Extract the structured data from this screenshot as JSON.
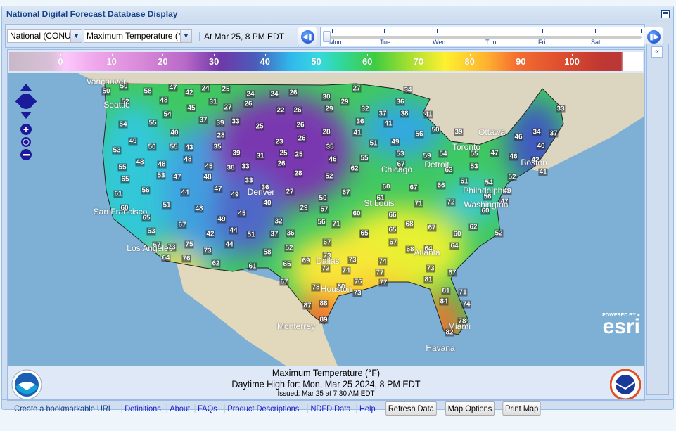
{
  "window": {
    "title": "National Digital Forecast Database Display"
  },
  "toolbar": {
    "region_select": "National (CONUS",
    "element_select": "Maximum Temperature (°F",
    "valid_time": "At Mar 25,   8 PM EDT",
    "timeline_days": [
      "Mon",
      "Tue",
      "Wed",
      "Thu",
      "Fri",
      "Sat"
    ],
    "timeline_position": 0
  },
  "legend": {
    "ticks": [
      "0",
      "10",
      "20",
      "30",
      "40",
      "50",
      "60",
      "70",
      "80",
      "90",
      "100"
    ],
    "unit": "°F"
  },
  "map": {
    "temperature_labels": [
      "50",
      "50",
      "58",
      "47",
      "42",
      "24",
      "25",
      "24",
      "24",
      "26",
      "30",
      "29",
      "27",
      "52",
      "48",
      "31",
      "27",
      "26",
      "22",
      "26",
      "29",
      "32",
      "45",
      "54",
      "54",
      "55",
      "37",
      "39",
      "33",
      "25",
      "26",
      "36",
      "40",
      "28",
      "28",
      "41",
      "49",
      "50",
      "55",
      "43",
      "35",
      "39",
      "31",
      "23",
      "26",
      "35",
      "53",
      "25",
      "25",
      "48",
      "48",
      "48",
      "26",
      "46",
      "55",
      "55",
      "45",
      "38",
      "33",
      "28",
      "62",
      "65",
      "53",
      "47",
      "48",
      "33",
      "52",
      "61",
      "56",
      "44",
      "47",
      "49",
      "36",
      "27",
      "67",
      "50",
      "60",
      "51",
      "48",
      "40",
      "29",
      "57",
      "60",
      "45",
      "34",
      "36",
      "37",
      "38",
      "41",
      "41",
      "50",
      "39",
      "56",
      "49",
      "51",
      "53",
      "59",
      "54",
      "55",
      "47",
      "46",
      "34",
      "37",
      "33",
      "40",
      "46",
      "42",
      "41",
      "67",
      "63",
      "53",
      "52",
      "61",
      "54",
      "60",
      "67",
      "66",
      "49",
      "56",
      "47",
      "61",
      "71",
      "72",
      "60",
      "66",
      "65",
      "63",
      "67",
      "49",
      "44",
      "42",
      "51",
      "37",
      "36",
      "32",
      "56",
      "71",
      "65",
      "67",
      "73",
      "75",
      "73",
      "44",
      "58",
      "52",
      "67",
      "73",
      "73",
      "64",
      "76",
      "62",
      "61",
      "65",
      "69",
      "72",
      "74",
      "67",
      "78",
      "80",
      "76",
      "73",
      "87",
      "88",
      "89",
      "68",
      "67",
      "62",
      "52",
      "65",
      "65",
      "60",
      "67",
      "68",
      "64",
      "64",
      "74",
      "73",
      "67",
      "77",
      "77",
      "81",
      "81",
      "71",
      "84",
      "74",
      "78",
      "82"
    ],
    "cities": [
      "Vancouver",
      "Seattle",
      "San Francisco",
      "Los Angeles",
      "Denver",
      "Dallas",
      "Houston",
      "Monterrey",
      "St Louis",
      "Chicago",
      "Detroit",
      "Toronto",
      "Ottawa",
      "Boston",
      "Philadelphia",
      "Washington",
      "Atlanta",
      "Miami",
      "Havana"
    ],
    "attribution": "POWERED BY esri"
  },
  "caption": {
    "title": "Maximum Temperature (°F)",
    "subtitle": "Daytime High for: Mon, Mar 25 2024,   8 PM EDT",
    "issued": "Issued: Mar 25 at 7:30 AM EDT"
  },
  "footer": {
    "links": [
      "Create a bookmarkable URL",
      "Definitions",
      "About",
      "FAQs",
      "Product Descriptions",
      "NDFD Data",
      "Help"
    ],
    "buttons": [
      "Refresh Data",
      "Map Options",
      "Print Map"
    ]
  },
  "colors": {
    "header": "#15428b",
    "link": "#1a1acc",
    "panel": "#d0def0"
  }
}
